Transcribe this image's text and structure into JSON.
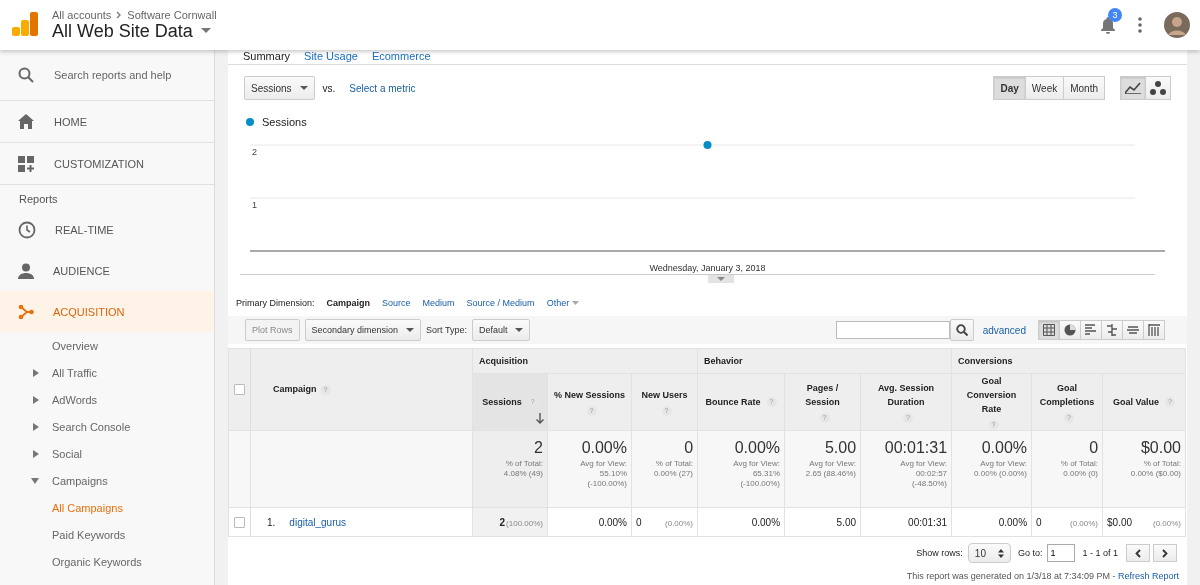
{
  "header": {
    "breadcrumb": [
      "All accounts",
      "Software Cornwall"
    ],
    "title": "All Web Site Data",
    "notification_count": "3"
  },
  "sidebar": {
    "search_placeholder": "Search reports and help",
    "top_items": [
      {
        "label": "HOME"
      },
      {
        "label": "CUSTOMIZATION"
      }
    ],
    "reports_heading": "Reports",
    "report_items": [
      {
        "label": "REAL-TIME",
        "selected": false
      },
      {
        "label": "AUDIENCE",
        "selected": false
      },
      {
        "label": "ACQUISITION",
        "selected": true,
        "children": [
          {
            "label": "Overview",
            "selected": false
          },
          {
            "label": "All Traffic",
            "selected": false,
            "expanded": false
          },
          {
            "label": "AdWords",
            "selected": false,
            "expanded": false
          },
          {
            "label": "Search Console",
            "selected": false,
            "expanded": false
          },
          {
            "label": "Social",
            "selected": false,
            "expanded": false
          },
          {
            "label": "Campaigns",
            "selected": false,
            "expanded": true,
            "children": [
              {
                "label": "All Campaigns",
                "selected": true
              },
              {
                "label": "Paid Keywords",
                "selected": false
              },
              {
                "label": "Organic Keywords",
                "selected": false
              }
            ]
          }
        ]
      }
    ]
  },
  "explorer_tabs": [
    {
      "label": "Summary",
      "selected": true
    },
    {
      "label": "Site Usage",
      "selected": false
    },
    {
      "label": "Ecommerce",
      "selected": false
    }
  ],
  "metric_select": "Sessions",
  "vs_label": "vs.",
  "select_metric_link": "Select a metric",
  "periods": [
    {
      "label": "Day",
      "selected": true
    },
    {
      "label": "Week",
      "selected": false
    },
    {
      "label": "Month",
      "selected": false
    }
  ],
  "chart_view_buttons": [
    {
      "selected": true
    },
    {
      "selected": false
    }
  ],
  "chart": {
    "chart_data": {
      "type": "line",
      "categories": [
        "Wednesday, January 3, 2018"
      ],
      "series": [
        {
          "name": "Sessions",
          "color": "#058dc7",
          "marker": "circle",
          "values": [
            2
          ]
        }
      ],
      "ylim": [
        0,
        2
      ],
      "yticks": [
        1,
        2
      ]
    }
  },
  "primary_dimension": {
    "label": "Primary Dimension:",
    "options": [
      {
        "label": "Campaign",
        "selected": true,
        "kind": "link"
      },
      {
        "label": "Source",
        "selected": false,
        "kind": "link"
      },
      {
        "label": "Medium",
        "selected": false,
        "kind": "link"
      },
      {
        "label": "Source / Medium",
        "selected": false,
        "kind": "link"
      },
      {
        "label": "Other",
        "selected": false,
        "kind": "menu"
      }
    ]
  },
  "toolbar": {
    "plot_rows": {
      "label": "Plot Rows",
      "disabled": true
    },
    "secondary_dimension": "Secondary dimension",
    "sort_type_label": "Sort Type:",
    "sort_type": "Default",
    "advanced_link": "advanced",
    "views": [
      {
        "selected": true
      },
      {
        "selected": false
      },
      {
        "selected": false
      },
      {
        "selected": false
      },
      {
        "selected": false
      },
      {
        "selected": false
      }
    ]
  },
  "table": {
    "first_column": "Campaign",
    "first_column_help": "?",
    "select_all_checked": false,
    "groups": [
      {
        "label": "Acquisition",
        "columns": [
          {
            "label": "Sessions",
            "help": "?",
            "sorted": true
          },
          {
            "label": "% New Sessions",
            "help": "?",
            "sorted": false
          },
          {
            "label": "New Users",
            "help": "?",
            "sorted": false
          }
        ]
      },
      {
        "label": "Behavior",
        "columns": [
          {
            "label": "Bounce Rate",
            "help": "?",
            "sorted": false
          },
          {
            "label": "Pages / Session",
            "help": "?",
            "sorted": false
          },
          {
            "label": "Avg. Session Duration",
            "help": "?",
            "sorted": false
          }
        ]
      },
      {
        "label": "Conversions",
        "columns": [
          {
            "label": "Goal Conversion Rate",
            "help": "?",
            "sorted": false
          },
          {
            "label": "Goal Completions",
            "help": "?",
            "sorted": false
          },
          {
            "label": "Goal Value",
            "help": "?",
            "sorted": false
          }
        ]
      }
    ],
    "totals": [
      {
        "value": "2",
        "note": [
          "% of Total:",
          "4.08% (49)"
        ]
      },
      {
        "value": "0.00%",
        "note": [
          "Avg for View:",
          "55.10%",
          "(-100.00%)"
        ]
      },
      {
        "value": "0",
        "note": [
          "% of Total:",
          "0.00% (27)"
        ]
      },
      {
        "value": "0.00%",
        "note": [
          "Avg for View:",
          "65.31%",
          "(-100.00%)"
        ]
      },
      {
        "value": "5.00",
        "note": [
          "Avg for View:",
          "2.65 (88.46%)"
        ]
      },
      {
        "value": "00:01:31",
        "note": [
          "Avg for View:",
          "00:02:57",
          "(-48.50%)"
        ]
      },
      {
        "value": "0.00%",
        "note": [
          "Avg for View:",
          "0.00% (0.00%)"
        ]
      },
      {
        "value": "0",
        "note": [
          "% of Total:",
          "0.00% (0)"
        ]
      },
      {
        "value": "$0.00",
        "note": [
          "% of Total:",
          "0.00% ($0.00)"
        ]
      }
    ],
    "rows": [
      {
        "checked": false,
        "index": "1.",
        "campaign": "digital_gurus",
        "cells": [
          {
            "value": "2",
            "pct": "(100.00%)"
          },
          {
            "value": "0.00%"
          },
          {
            "value": "0",
            "pct": "(0.00%)"
          },
          {
            "value": "0.00%"
          },
          {
            "value": "5.00"
          },
          {
            "value": "00:01:31"
          },
          {
            "value": "0.00%"
          },
          {
            "value": "0",
            "pct": "(0.00%)"
          },
          {
            "value": "$0.00",
            "pct": "(0.00%)"
          }
        ]
      }
    ]
  },
  "pagination": {
    "show_rows_label": "Show rows:",
    "show_rows": "10",
    "goto_label": "Go to:",
    "goto_value": "1",
    "range": "1 - 1 of 1"
  },
  "report_note": "This report was generated on 1/3/18 at 7:34:09 PM - ",
  "refresh_link": "Refresh Report"
}
